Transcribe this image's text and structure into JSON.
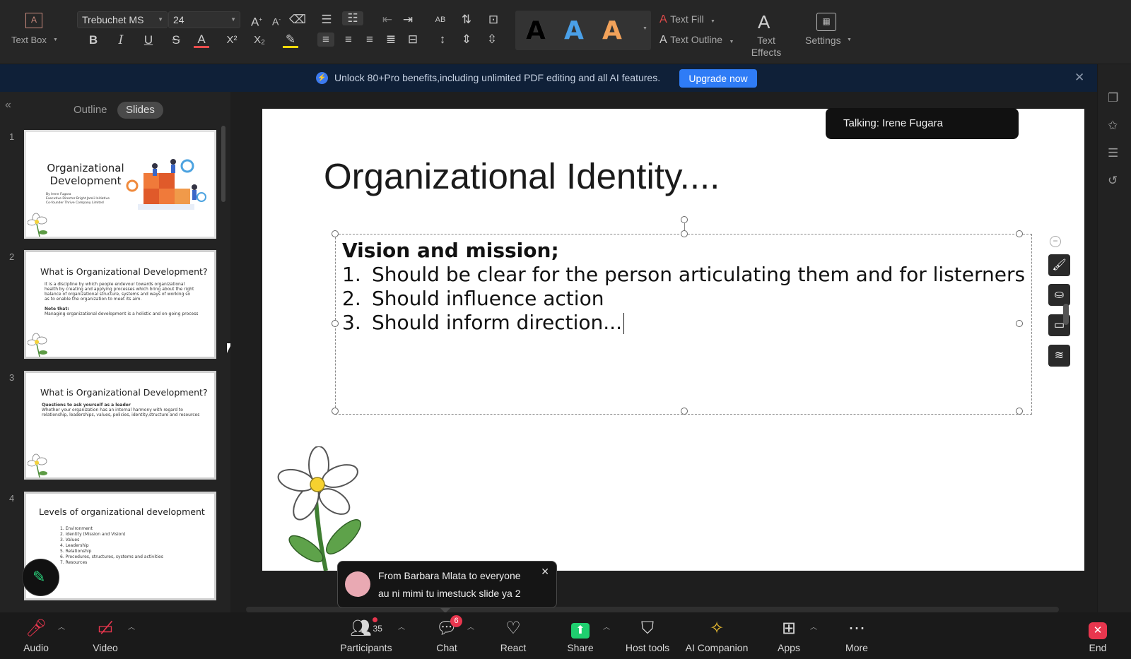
{
  "ribbon": {
    "text_box_label": "Text Box",
    "font_name": "Trebuchet MS",
    "font_size": "24",
    "text_fill_label": "Text Fill",
    "text_outline_label": "Text Outline",
    "text_effects_label": "Text Effects",
    "settings_label": "Settings",
    "style_samples": [
      "A",
      "A",
      "A"
    ],
    "format_glyphs": {
      "bold": "B",
      "italic": "I",
      "underline": "U",
      "strike": "S",
      "font_color": "A",
      "superscript": "X²",
      "subscript": "X₂"
    }
  },
  "banner": {
    "message": "Unlock 80+Pro benefits,including unlimited PDF editing and all AI features.",
    "button": "Upgrade now"
  },
  "panel": {
    "tabs": [
      "Outline",
      "Slides"
    ],
    "active_tab": "Slides",
    "slides": [
      {
        "num": "1",
        "title": "Organizational Development",
        "lines": [
          "By Irene Fugara",
          "Executive Director Bright Jamii Initiative",
          "Co-founder Thrive Company Limited"
        ]
      },
      {
        "num": "2",
        "title": "What is Organizational Development?",
        "lines": [
          "It is a discipline by which people endevour towards organizational",
          "health by creating and applying processes which bring about the right",
          "balance of organizational structure, systems and ways of working so",
          "as to enable the organization to meet its aim.",
          "",
          "Note that:",
          "Managing organizational development is a holistic and on-going process"
        ]
      },
      {
        "num": "3",
        "title": "What is Organizational Development?",
        "lines": [
          "Questions to ask yourself as a leader",
          "Whether your organization has an internal harmony with regard to",
          "relationship, leaderships, values, policies, identity,structure and resources"
        ]
      },
      {
        "num": "4",
        "title": "Levels of organizational development",
        "lines": [
          "1. Environment",
          "2. Identity (Mission and Vision)",
          "3. Values",
          "4. Leadership",
          "5. Relationship",
          "6. Procedures, structures, systems and activities",
          "7. Resources"
        ]
      }
    ]
  },
  "slide": {
    "title": "Organizational Identity....",
    "heading": "Vision and mission;",
    "items": [
      {
        "n": "1.",
        "text": "Should be clear for the person articulating them and for listerners"
      },
      {
        "n": "2.",
        "text": "Should influence action"
      },
      {
        "n": "3.",
        "text": "Should inform direction..."
      }
    ]
  },
  "talking": "Talking: Irene Fugara",
  "chat_toast": {
    "from": "From Barbara Mlata to everyone",
    "message": "au ni mimi tu imestuck slide ya 2"
  },
  "meeting_bar": {
    "audio": "Audio",
    "video": "Video",
    "participants": "Participants",
    "participants_count": "35",
    "chat": "Chat",
    "chat_badge": "6",
    "react": "React",
    "share": "Share",
    "host_tools": "Host tools",
    "ai_companion": "AI Companion",
    "apps": "Apps",
    "more": "More",
    "end": "End"
  },
  "colors": {
    "accent": "#2f7cf6",
    "banner_bg": "#0f2038",
    "share_green": "#1fcf6f",
    "end_red": "#e8364e"
  }
}
